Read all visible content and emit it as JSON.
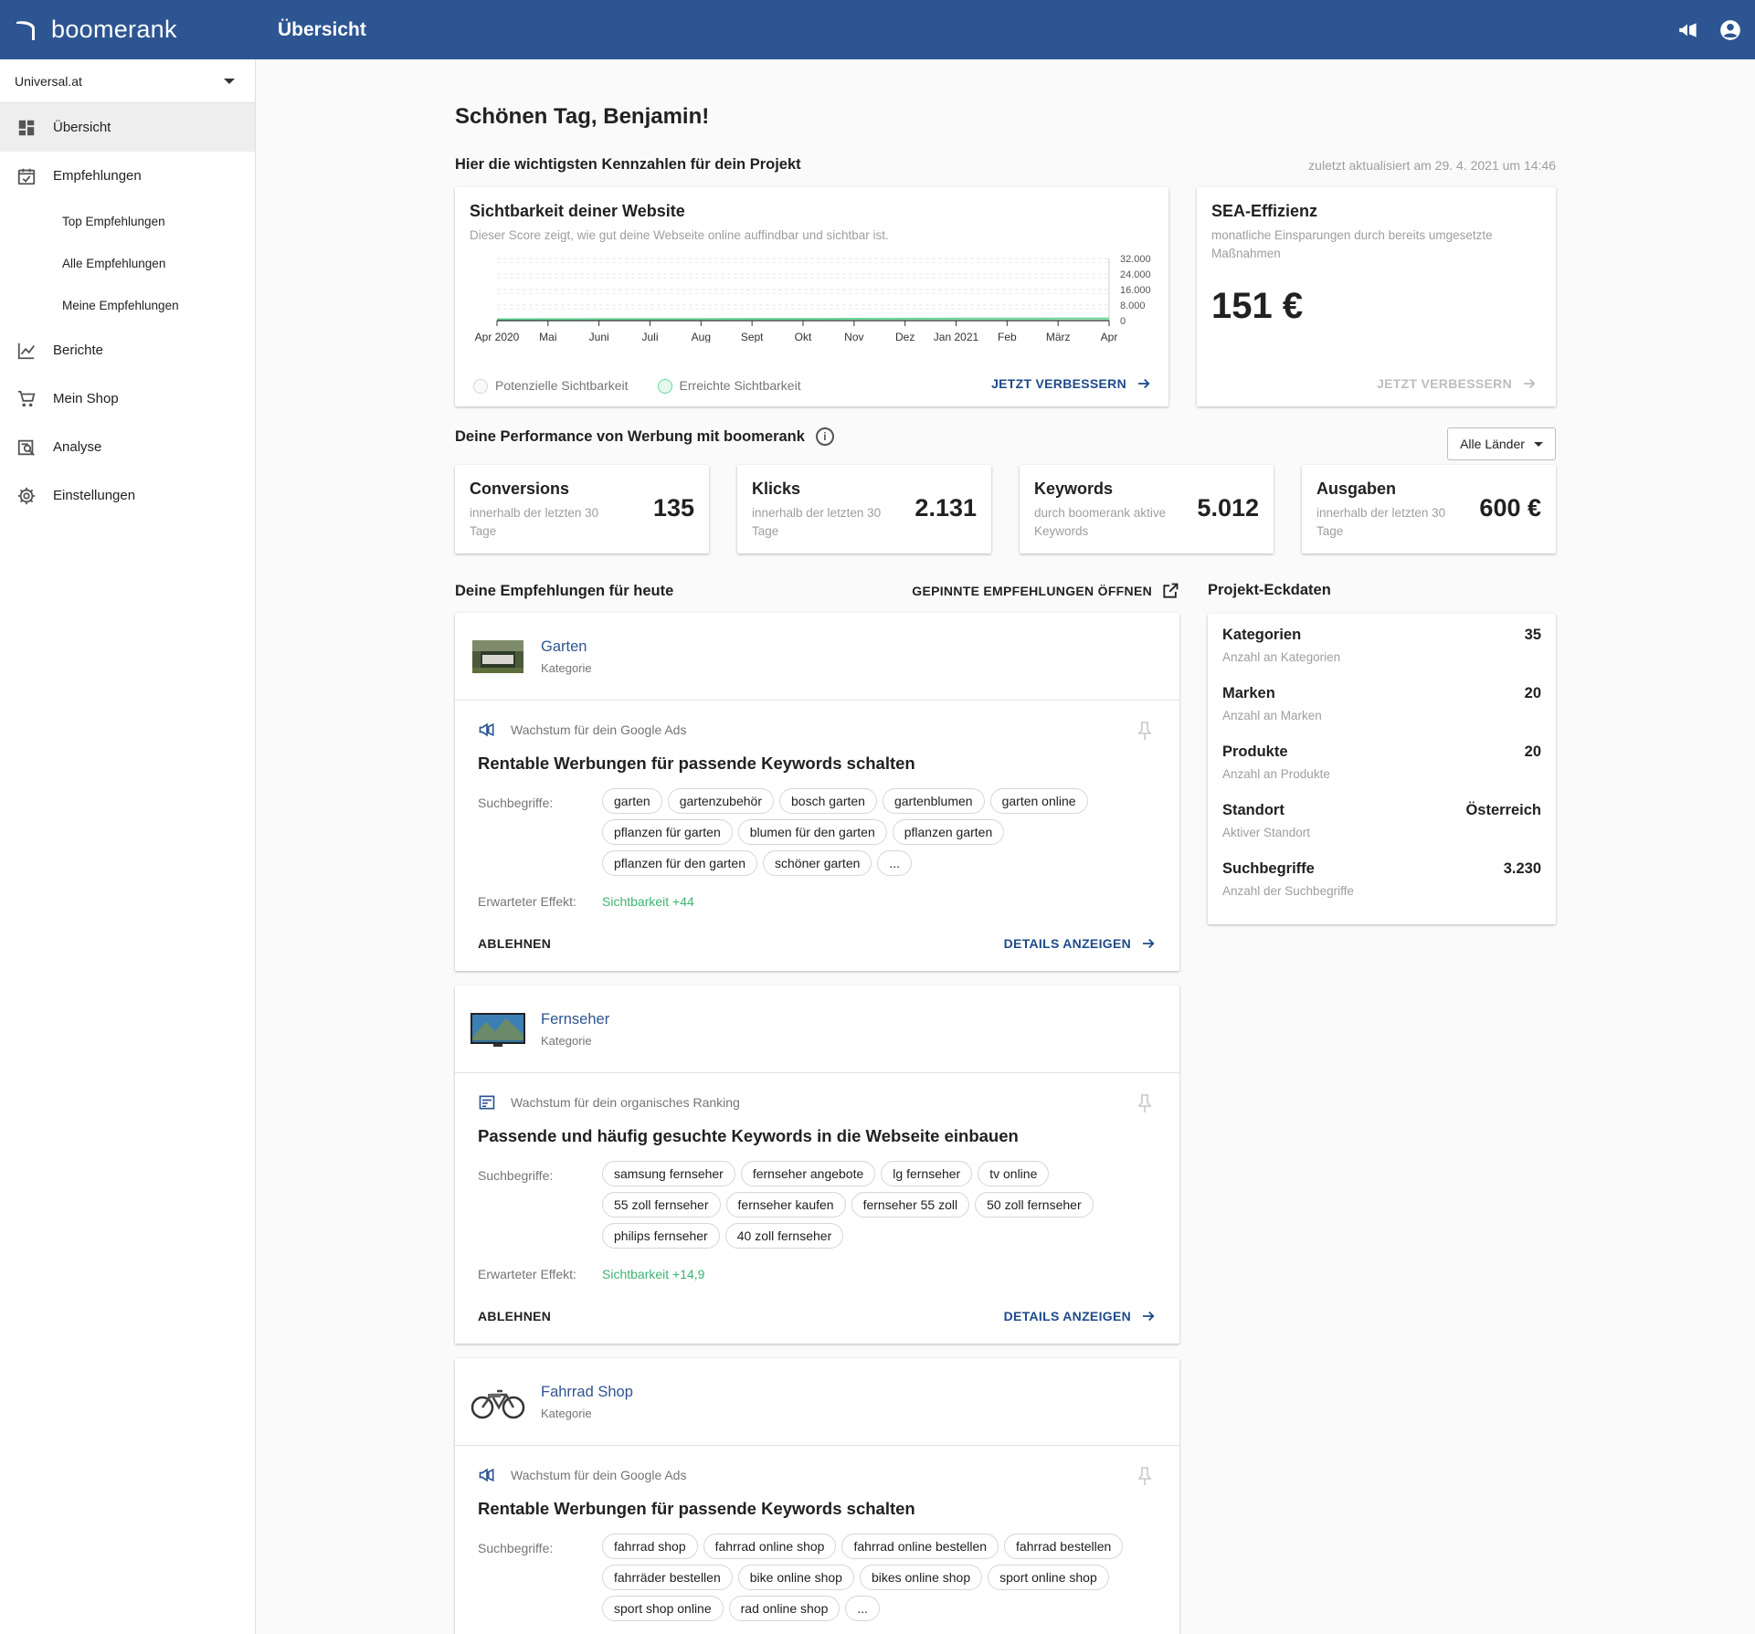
{
  "app": {
    "logo_text": "boomerank",
    "page_title": "Übersicht"
  },
  "sidebar": {
    "project": "Universal.at",
    "items": [
      {
        "label": "Übersicht"
      },
      {
        "label": "Empfehlungen"
      },
      {
        "label": "Top Empfehlungen"
      },
      {
        "label": "Alle Empfehlungen"
      },
      {
        "label": "Meine Empfehlungen"
      },
      {
        "label": "Berichte"
      },
      {
        "label": "Mein Shop"
      },
      {
        "label": "Analyse"
      },
      {
        "label": "Einstellungen"
      }
    ]
  },
  "main": {
    "greeting": "Schönen Tag, Benjamin!",
    "kpi_heading": "Hier die wichtigsten Kennzahlen für dein Projekt",
    "updated": "zuletzt aktualisiert am 29. 4. 2021 um 14:46",
    "visibility": {
      "title": "Sichtbarkeit deiner Website",
      "subtitle": "Dieser Score zeigt, wie gut deine Webseite online auffindbar und sichtbar ist.",
      "legend_potential": "Potenzielle Sichtbarkeit",
      "legend_reached": "Erreichte Sichtbarkeit",
      "action": "JETZT VERBESSERN"
    },
    "sea": {
      "title": "SEA-Effizienz",
      "subtitle": "monatliche Einsparungen durch bereits umgesetzte Maßnahmen",
      "value": "151 €",
      "action": "JETZT VERBESSERN"
    },
    "performance_heading": "Deine Performance von Werbung mit boomerank",
    "country_filter": "Alle Länder",
    "metrics": [
      {
        "title": "Conversions",
        "sub": "innerhalb der letzten 30 Tage",
        "value": "135"
      },
      {
        "title": "Klicks",
        "sub": "innerhalb der letzten 30 Tage",
        "value": "2.131"
      },
      {
        "title": "Keywords",
        "sub": "durch boomerank aktive Keywords",
        "value": "5.012"
      },
      {
        "title": "Ausgaben",
        "sub": "innerhalb der letzten 30 Tage",
        "value": "600 €"
      }
    ],
    "recommendations_heading": "Deine Empfehlungen für heute",
    "pinned_link": "GEPINNTE EMPFEHLUNGEN ÖFFNEN",
    "keywords_label": "Suchbegriffe:",
    "effect_label": "Erwarteter Effekt:",
    "reject_label": "ABLEHNEN",
    "details_label": "DETAILS ANZEIGEN",
    "recommendations": [
      {
        "category": "Garten",
        "category_type": "Kategorie",
        "kind": "Wachstum für dein Google Ads",
        "title": "Rentable Werbungen für passende Keywords schalten",
        "chips": [
          "garten",
          "gartenzubehör",
          "bosch garten",
          "gartenblumen",
          "garten online",
          "pflanzen für garten",
          "blumen für den garten",
          "pflanzen garten",
          "pflanzen für den garten",
          "schöner garten",
          "..."
        ],
        "effect": "Sichtbarkeit +44"
      },
      {
        "category": "Fernseher",
        "category_type": "Kategorie",
        "kind": "Wachstum für dein organisches Ranking",
        "title": "Passende und häufig gesuchte Keywords in die Webseite einbauen",
        "chips": [
          "samsung fernseher",
          "fernseher angebote",
          "lg fernseher",
          "tv online",
          "55 zoll fernseher",
          "fernseher kaufen",
          "fernseher 55 zoll",
          "50 zoll fernseher",
          "philips fernseher",
          "40 zoll fernseher"
        ],
        "effect": "Sichtbarkeit +14,9"
      },
      {
        "category": "Fahrrad Shop",
        "category_type": "Kategorie",
        "kind": "Wachstum für dein Google Ads",
        "title": "Rentable Werbungen für passende Keywords schalten",
        "chips": [
          "fahrrad shop",
          "fahrrad online shop",
          "fahrrad online bestellen",
          "fahrrad bestellen",
          "fahrräder bestellen",
          "bike online shop",
          "bikes online shop",
          "sport online shop",
          "sport shop online",
          "rad online shop",
          "..."
        ],
        "effect": ""
      }
    ],
    "facts_heading": "Projekt-Eckdaten",
    "facts": [
      {
        "title": "Kategorien",
        "sub": "Anzahl an Kategorien",
        "value": "35"
      },
      {
        "title": "Marken",
        "sub": "Anzahl an Marken",
        "value": "20"
      },
      {
        "title": "Produkte",
        "sub": "Anzahl an Produkte",
        "value": "20"
      },
      {
        "title": "Standort",
        "sub": "Aktiver Standort",
        "value": "Österreich"
      },
      {
        "title": "Suchbegriffe",
        "sub": "Anzahl der Suchbegriffe",
        "value": "3.230"
      }
    ]
  },
  "chart_data": {
    "type": "area",
    "categories": [
      "Apr 2020",
      "Mai",
      "Juni",
      "Juli",
      "Aug",
      "Sept",
      "Okt",
      "Nov",
      "Dez",
      "Jan 2021",
      "Feb",
      "März",
      "Apr"
    ],
    "yticks": [
      "32.000",
      "24.000",
      "16.000",
      "8.000",
      "0"
    ],
    "ylim": [
      0,
      32000
    ],
    "series": [
      {
        "name": "Potenzielle Sichtbarkeit",
        "color": "#e0e0e0",
        "values": [
          0,
          0,
          0,
          0,
          0,
          0,
          0,
          0,
          0,
          0,
          0,
          0,
          0
        ]
      },
      {
        "name": "Erreichte Sichtbarkeit",
        "color": "#69d79a",
        "values": [
          700,
          750,
          800,
          820,
          850,
          870,
          900,
          950,
          1000,
          1050,
          1050,
          1100,
          1100
        ]
      }
    ]
  }
}
